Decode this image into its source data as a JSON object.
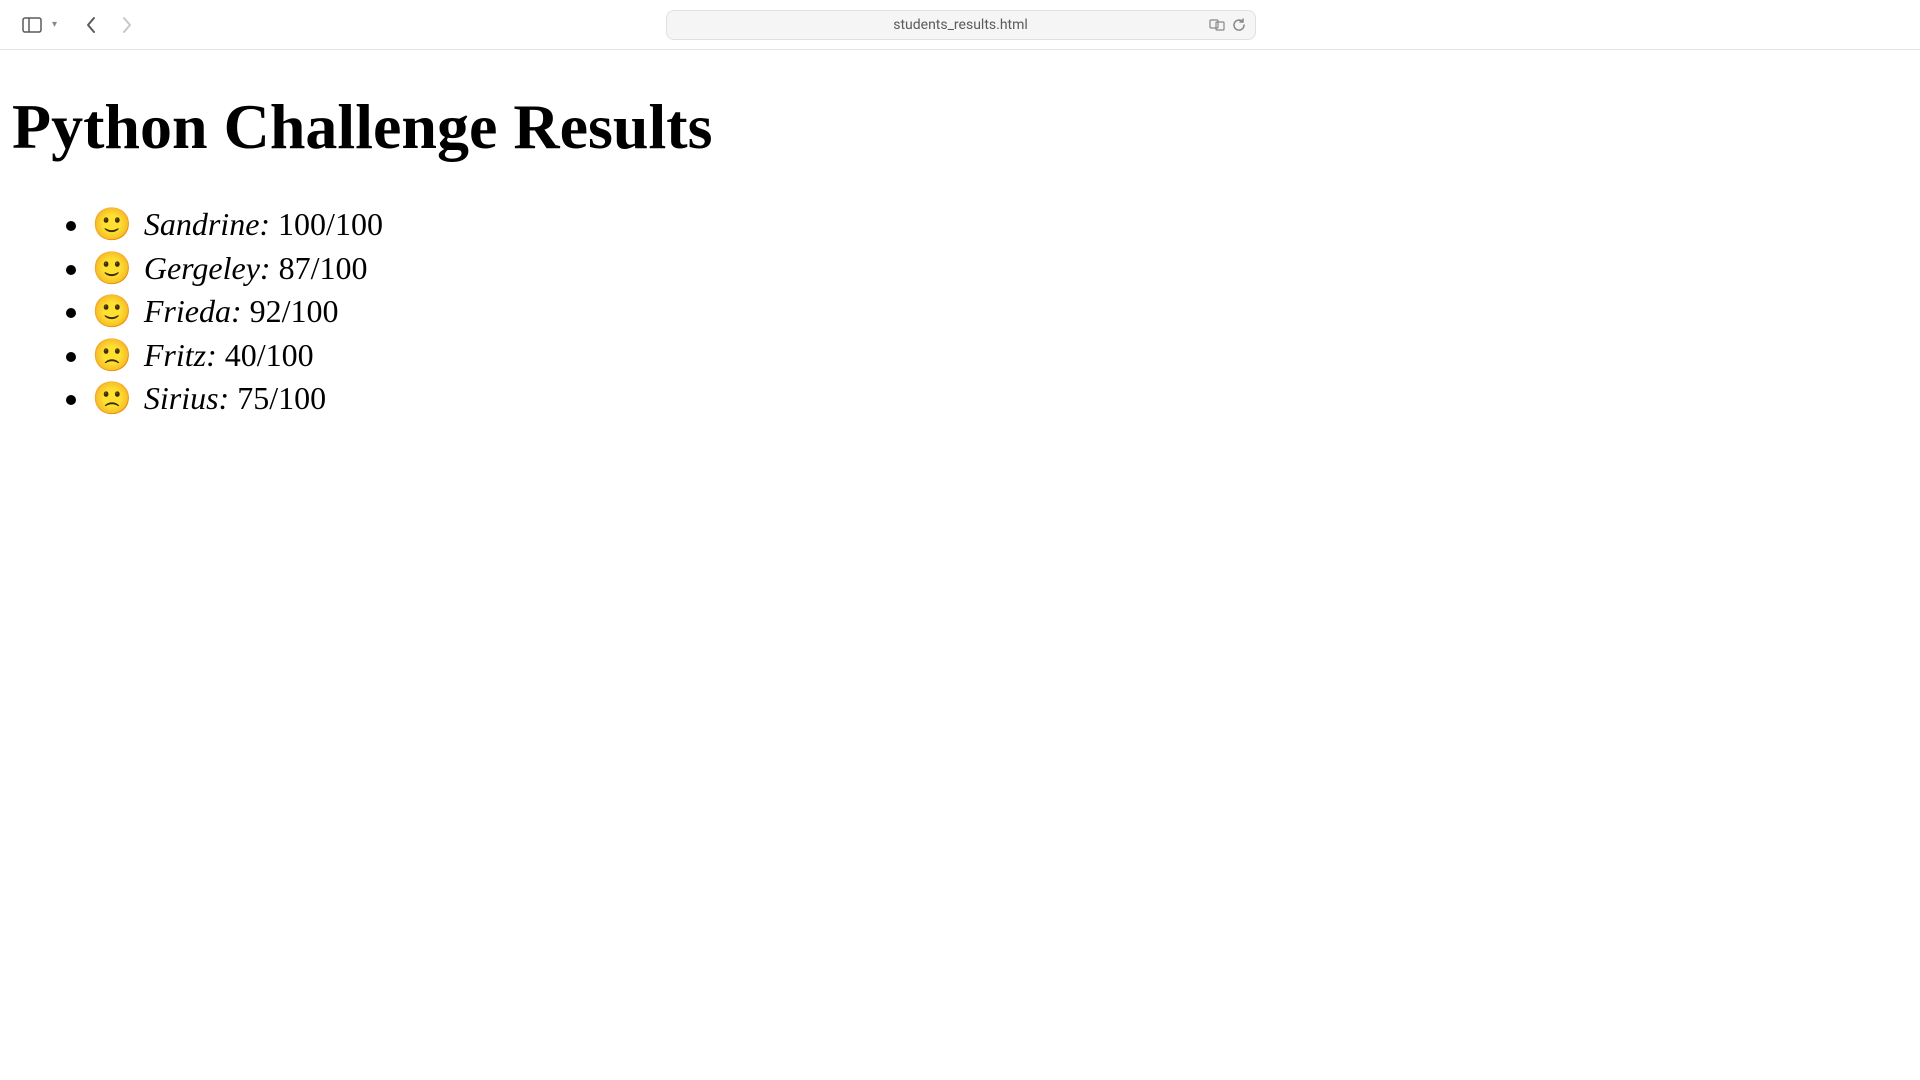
{
  "browser": {
    "url": "students_results.html"
  },
  "page": {
    "title": "Python Challenge Results",
    "results": [
      {
        "emoji": "🙂",
        "name": "Sandrine:",
        "score": "100/100"
      },
      {
        "emoji": "🙂",
        "name": "Gergeley:",
        "score": "87/100"
      },
      {
        "emoji": "🙂",
        "name": "Frieda:",
        "score": "92/100"
      },
      {
        "emoji": "🙁",
        "name": "Fritz:",
        "score": "40/100"
      },
      {
        "emoji": "🙁",
        "name": "Sirius:",
        "score": "75/100"
      }
    ]
  }
}
